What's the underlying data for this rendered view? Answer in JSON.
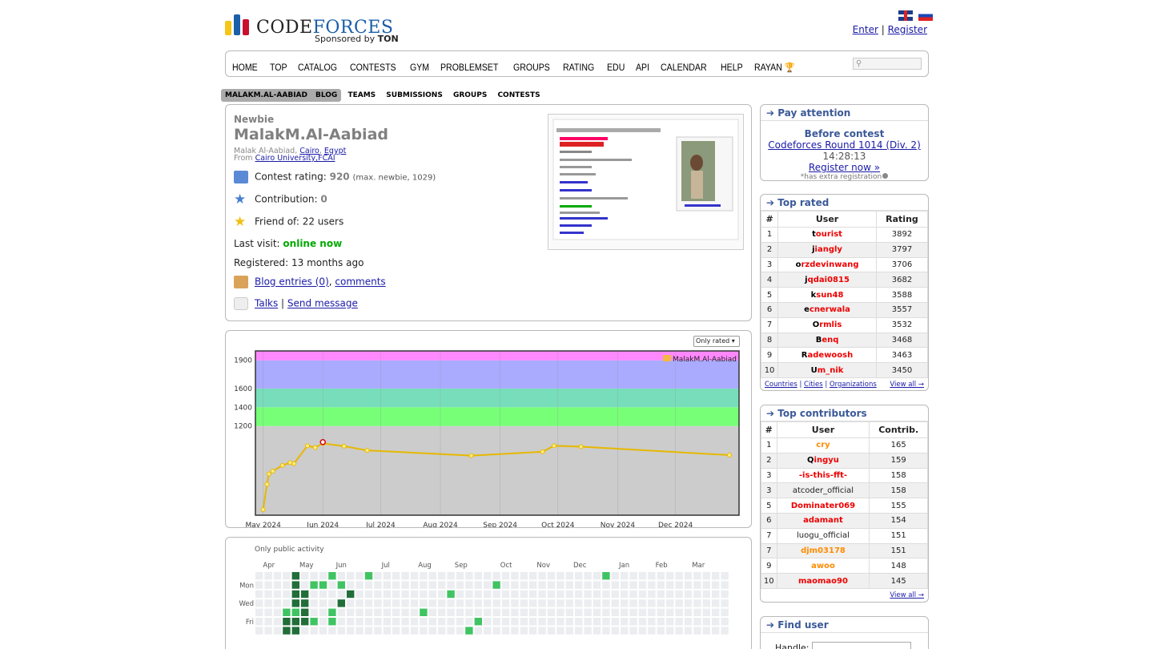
{
  "header": {
    "logo_word": "CODEFORCES",
    "logo_code": "CODE",
    "logo_forces": "FORCES",
    "sponsored": "Sponsored by",
    "sponsor": "TON",
    "enter": "Enter",
    "separator": "|",
    "register": "Register",
    "colors": {
      "bar1": "#f5c518",
      "bar2": "#1a5fa8",
      "bar3": "#c8102e"
    }
  },
  "menu": [
    "HOME",
    "TOP",
    "CATALOG",
    "CONTESTS",
    "GYM",
    "PROBLEMSET",
    "GROUPS",
    "RATING",
    "EDU",
    "API",
    "CALENDAR",
    "HELP",
    "RAYAN"
  ],
  "second_menu": [
    "MALAKM.AL-AABIAD",
    "BLOG",
    "TEAMS",
    "SUBMISSIONS",
    "GROUPS",
    "CONTESTS"
  ],
  "profile": {
    "rank": "Newbie",
    "handle": "MalakM.Al-Aabiad",
    "name": "Malak Al-Aabiad,",
    "city": "Cairo",
    "country": "Egypt",
    "from": "From",
    "org": "Cairo University,FCAI",
    "rating_label": "Contest rating:",
    "rating": "920",
    "rating_max": "(max. newbie, 1029)",
    "contribution_label": "Contribution:",
    "contribution": "0",
    "friends": "Friend of: 22 users",
    "last_visit_label": "Last visit:",
    "last_visit": "online now",
    "registered": "Registered: 13 months ago",
    "blog_entries": "Blog entries (0)",
    "comments": "comments",
    "talks": "Talks",
    "send_message": "Send message"
  },
  "pay_attention": {
    "title": "Pay attention",
    "before": "Before contest",
    "contest": "Codeforces Round 1014 (Div. 2)",
    "time": "14:28:13",
    "register": "Register now »",
    "note": "*has extra registration"
  },
  "top_rated": {
    "title": "Top rated",
    "headers": [
      "#",
      "User",
      "Rating"
    ],
    "rows": [
      {
        "n": "1",
        "first": "t",
        "rest": "ourist",
        "v": "3892"
      },
      {
        "n": "2",
        "first": "j",
        "rest": "iangly",
        "v": "3797"
      },
      {
        "n": "3",
        "first": "o",
        "rest": "rzdevinwang",
        "v": "3706"
      },
      {
        "n": "4",
        "first": "j",
        "rest": "qdai0815",
        "v": "3682"
      },
      {
        "n": "5",
        "first": "k",
        "rest": "sun48",
        "v": "3588"
      },
      {
        "n": "6",
        "first": "e",
        "rest": "cnerwala",
        "v": "3557"
      },
      {
        "n": "7",
        "first": "O",
        "rest": "rmlis",
        "v": "3532"
      },
      {
        "n": "8",
        "first": "B",
        "rest": "enq",
        "v": "3468"
      },
      {
        "n": "9",
        "first": "R",
        "rest": "adewoosh",
        "v": "3463"
      },
      {
        "n": "10",
        "first": "U",
        "rest": "m_nik",
        "v": "3450"
      }
    ],
    "links": [
      "Countries",
      "Cities",
      "Organizations"
    ],
    "view_all": "View all →"
  },
  "top_contributors": {
    "title": "Top contributors",
    "headers": [
      "#",
      "User",
      "Contrib."
    ],
    "rows": [
      {
        "n": "1",
        "u": "cry",
        "c": "org",
        "v": "165"
      },
      {
        "n": "2",
        "u": "Qingyu",
        "c": "mix",
        "v": "159"
      },
      {
        "n": "3",
        "u": "-is-this-fft-",
        "c": "red",
        "v": "158"
      },
      {
        "n": "3",
        "u": "atcoder_official",
        "c": "plain",
        "v": "158"
      },
      {
        "n": "5",
        "u": "Dominater069",
        "c": "red",
        "v": "155"
      },
      {
        "n": "6",
        "u": "adamant",
        "c": "red",
        "v": "154"
      },
      {
        "n": "7",
        "u": "luogu_official",
        "c": "plain",
        "v": "151"
      },
      {
        "n": "7",
        "u": "djm03178",
        "c": "org",
        "v": "151"
      },
      {
        "n": "9",
        "u": "awoo",
        "c": "org",
        "v": "148"
      },
      {
        "n": "10",
        "u": "maomao90",
        "c": "red",
        "v": "145"
      }
    ],
    "view_all": "View all →"
  },
  "find_user": {
    "title": "Find user",
    "handle_label": "Handle:"
  },
  "graph": {
    "select": "Only rated",
    "legend": "MalakM.Al-Aabiad"
  },
  "chart_data": {
    "type": "line",
    "series": [
      {
        "name": "MalakM.Al-Aabiad",
        "x": [
          "2024-05-01",
          "2024-05-03",
          "2024-05-04",
          "2024-05-06",
          "2024-05-11",
          "2024-05-15",
          "2024-05-17",
          "2024-05-24",
          "2024-05-28",
          "2024-06-01",
          "2024-06-12",
          "2024-06-24",
          "2024-08-17",
          "2024-09-23",
          "2024-09-29",
          "2024-10-13",
          "2024-12-29"
        ],
        "values": [
          310,
          580,
          690,
          720,
          780,
          810,
          800,
          990,
          970,
          1015,
          985,
          940,
          885,
          925,
          990,
          980,
          890
        ]
      }
    ],
    "highlight": {
      "x": "2024-06-01",
      "y": 1029
    },
    "y_ticks": [
      1200,
      1400,
      1600,
      1900
    ],
    "x_ticks": [
      "May 2024",
      "Jun 2024",
      "Jul 2024",
      "Aug 2024",
      "Sep 2024",
      "Oct 2024",
      "Nov 2024",
      "Dec 2024"
    ],
    "ylim": [
      250,
      2000
    ],
    "bands": [
      {
        "from": 0,
        "to": 1200,
        "color": "#cccccc"
      },
      {
        "from": 1200,
        "to": 1400,
        "color": "#77ff77"
      },
      {
        "from": 1400,
        "to": 1600,
        "color": "#77ddbb"
      },
      {
        "from": 1600,
        "to": 1900,
        "color": "#aaaaff"
      },
      {
        "from": 1900,
        "to": 2100,
        "color": "#ff88ff"
      }
    ],
    "line_color": "#e6b800"
  },
  "activity": {
    "title": "Only public activity",
    "months": [
      "Apr",
      "May",
      "Jun",
      "Jul",
      "Aug",
      "Sep",
      "Oct",
      "Nov",
      "Dec",
      "Jan",
      "Feb",
      "Mar"
    ],
    "days": [
      "Mon",
      "Wed",
      "Fri"
    ]
  }
}
